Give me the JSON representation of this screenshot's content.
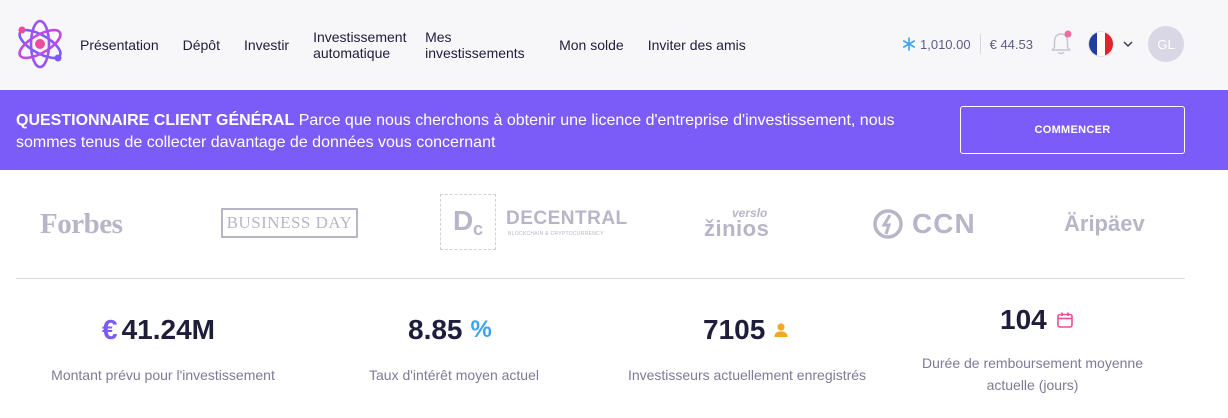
{
  "nav": {
    "items": [
      "Présentation",
      "Dépôt",
      "Investir",
      "Investissement automatique",
      "Mes investissements",
      "Mon solde",
      "Inviter des amis"
    ]
  },
  "balances": {
    "crypto": "1,010.00",
    "euro": "€ 44.53"
  },
  "user": {
    "initials": "GL",
    "language_flag": "france-flag"
  },
  "banner": {
    "title": "QUESTIONNAIRE CLIENT GÉNÉRAL",
    "text": "Parce que nous cherchons à obtenir une licence d'entreprise d'investissement, nous sommes tenus de collecter davantage de données vous concernant",
    "button_label": "COMMENCER"
  },
  "press": {
    "forbes": "Forbes",
    "business_day": "BUSINESS DAY",
    "decentral_mark": "D",
    "decentral_mark_sub": "c",
    "decentral": "DECENTRAL",
    "decentral_sub": "BLOCKCHAIN & CRYPTOCURRENCY",
    "zinios_top": "verslo",
    "zinios": "žinios",
    "ccn": "CCN",
    "aripaev": "Äripäev"
  },
  "stats": [
    {
      "value": "41.24M",
      "prefix": "€",
      "label": "Montant prévu pour l'investissement",
      "icon": "euro-icon"
    },
    {
      "value": "8.85",
      "suffix": "%",
      "label": "Taux d'intérêt moyen actuel",
      "icon": "percent-icon"
    },
    {
      "value": "7105",
      "label": "Investisseurs actuellement enregistrés",
      "icon": "user-icon"
    },
    {
      "value": "104",
      "label": "Durée de remboursement moyenne actuelle (jours)",
      "icon": "calendar-icon"
    }
  ],
  "colors": {
    "brand": "#7c5cf8",
    "header_bg": "#f7f7f9",
    "text_dark": "#1f1d3a",
    "text_muted": "#7d7b96",
    "logo_gray": "#b7b6c8",
    "percent": "#3ba3f0",
    "user_icon": "#f5a623",
    "calendar_icon": "#ec4c9b",
    "bell_dot": "#f06ba0"
  }
}
